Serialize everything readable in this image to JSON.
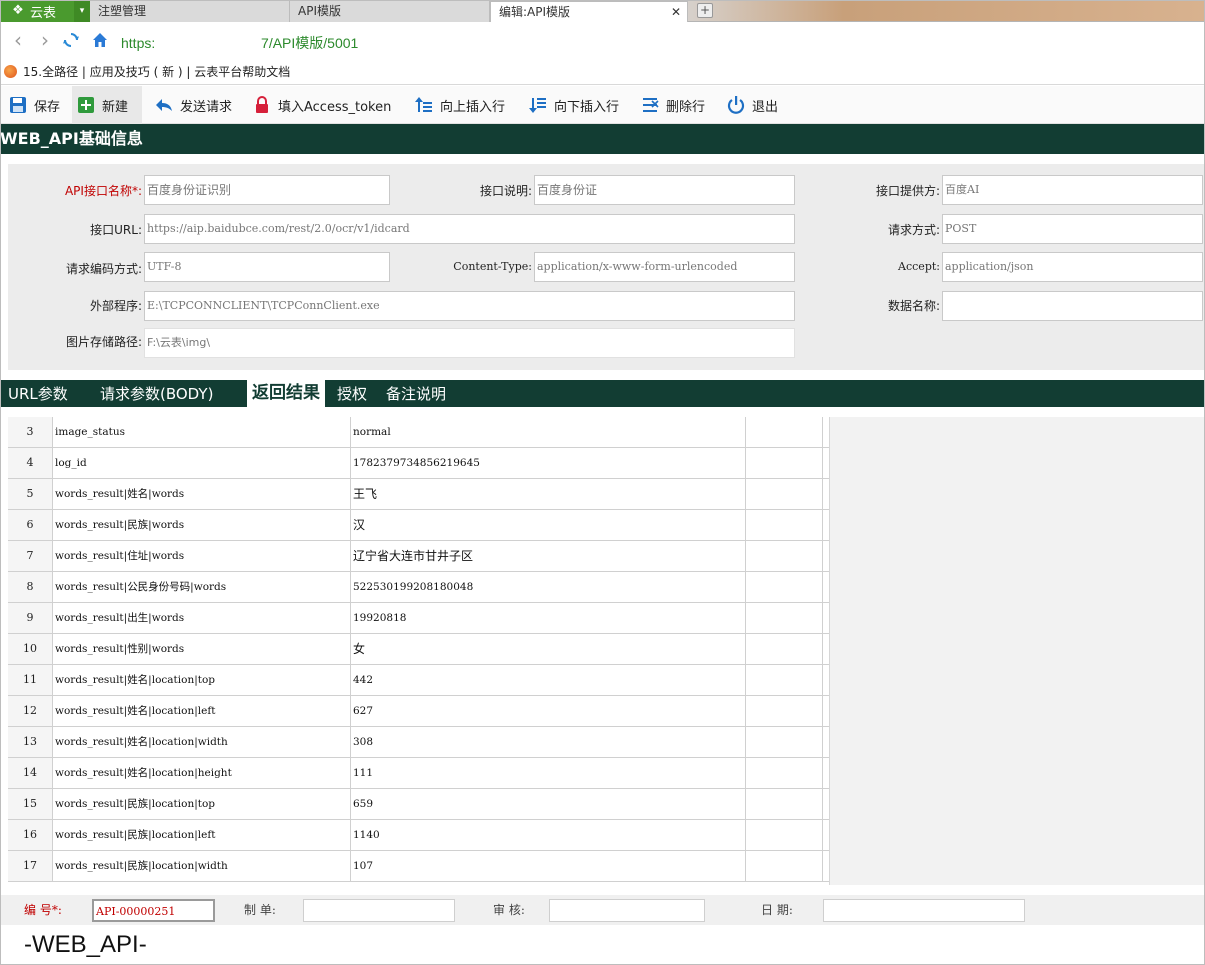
{
  "tabbar": {
    "app_name": "云表",
    "tabs": [
      {
        "label": "注塑管理"
      },
      {
        "label": "API模版"
      },
      {
        "label": "编辑:API模版",
        "close": "✕"
      }
    ],
    "new_tab": "+"
  },
  "address": {
    "url_prefix": "https:",
    "url_suffix": "7/API模版/5001"
  },
  "bookmarks": {
    "text": "15.全路径 | 应用及技巧 ( 新 ) | 云表平台帮助文档"
  },
  "toolbar": {
    "save": "保存",
    "new": "新建",
    "send": "发送请求",
    "fill_token": "填入Access_token",
    "insert_up": "向上插入行",
    "insert_down": "向下插入行",
    "delete_row": "删除行",
    "exit": "退出"
  },
  "section": {
    "title": "WEB_API基础信息"
  },
  "form": {
    "api_name_label": "API接口名称*:",
    "api_name_value": "百度身份证识别",
    "desc_label": "接口说明:",
    "desc_value": "百度身份证",
    "provider_label": "接口提供方:",
    "provider_value": "百度AI",
    "url_label": "接口URL:",
    "url_value": "https://aip.baidubce.com/rest/2.0/ocr/v1/idcard",
    "method_label": "请求方式:",
    "method_value": "POST",
    "encoding_label": "请求编码方式:",
    "encoding_value": "UTF-8",
    "content_type_label": "Content-Type:",
    "content_type_value": "application/x-www-form-urlencoded",
    "accept_label": "Accept:",
    "accept_value": "application/json",
    "external_label": "外部程序:",
    "external_value": "E:\\TCPCONNCLIENT\\TCPConnClient.exe",
    "dataname_label": "数据名称:",
    "dataname_value": "",
    "image_path_label": "图片存储路径:",
    "image_path_value": "F:\\云表\\img\\"
  },
  "subtabs": [
    {
      "label": "URL参数"
    },
    {
      "label": "请求参数(BODY)"
    },
    {
      "label": "返回结果"
    },
    {
      "label": "授权"
    },
    {
      "label": "备注说明"
    }
  ],
  "grid": {
    "rows": [
      {
        "num": "3",
        "key": "image_status",
        "value": "normal"
      },
      {
        "num": "4",
        "key": "log_id",
        "value": "1782379734856219645"
      },
      {
        "num": "5",
        "key": "words_result|姓名|words",
        "value": "王飞"
      },
      {
        "num": "6",
        "key": "words_result|民族|words",
        "value": "汉"
      },
      {
        "num": "7",
        "key": "words_result|住址|words",
        "value": "辽宁省大连市甘井子区"
      },
      {
        "num": "8",
        "key": "words_result|公民身份号码|words",
        "value": "522530199208180048"
      },
      {
        "num": "9",
        "key": "words_result|出生|words",
        "value": "19920818"
      },
      {
        "num": "10",
        "key": "words_result|性别|words",
        "value": "女"
      },
      {
        "num": "11",
        "key": "words_result|姓名|location|top",
        "value": "442"
      },
      {
        "num": "12",
        "key": "words_result|姓名|location|left",
        "value": "627"
      },
      {
        "num": "13",
        "key": "words_result|姓名|location|width",
        "value": "308"
      },
      {
        "num": "14",
        "key": "words_result|姓名|location|height",
        "value": "111"
      },
      {
        "num": "15",
        "key": "words_result|民族|location|top",
        "value": "659"
      },
      {
        "num": "16",
        "key": "words_result|民族|location|left",
        "value": "1140"
      },
      {
        "num": "17",
        "key": "words_result|民族|location|width",
        "value": "107"
      }
    ]
  },
  "footer": {
    "code_label": "编    号*:",
    "code_value": "API-00000251",
    "maker_label": "制    单:",
    "maker_value": "",
    "review_label": "审    核:",
    "review_value": "",
    "date_label": "日    期:",
    "date_value": ""
  },
  "bottom_title": "-WEB_API-",
  "colors": {
    "header_bg": "#123d33",
    "app_green": "#4a9a2e",
    "required_red": "#c00000",
    "url_green": "#2c8a2c"
  }
}
